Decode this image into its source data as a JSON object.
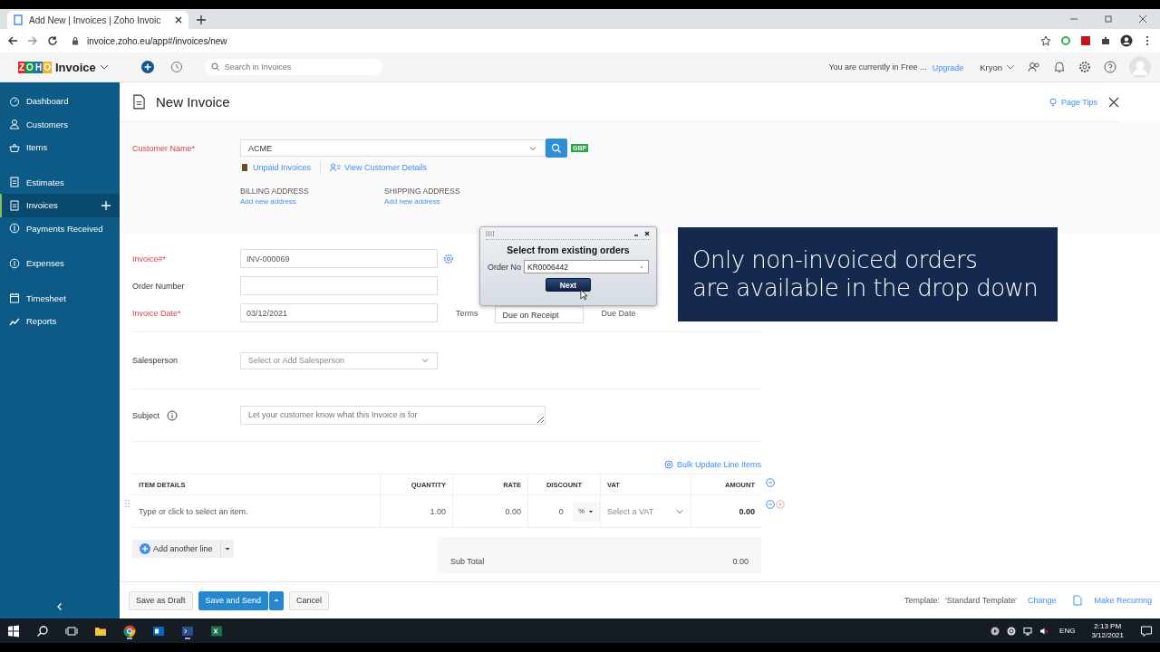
{
  "browser": {
    "tab_title": "Add New | Invoices | Zoho Invoic",
    "url": "invoice.zoho.eu/app#/invoices/new"
  },
  "app_header": {
    "logo_letters": "ZOHO",
    "logo_word": "Invoice",
    "search_placeholder": "Search in Invoices",
    "plan_notice": "You are currently in Free ...",
    "upgrade": "Upgrade",
    "org": "Kryon"
  },
  "sidebar": {
    "groups": [
      [
        {
          "label": "Dashboard",
          "selected": false,
          "add": false
        },
        {
          "label": "Customers",
          "selected": false,
          "add": false
        },
        {
          "label": "Items",
          "selected": false,
          "add": false
        }
      ],
      [
        {
          "label": "Estimates",
          "selected": false,
          "add": false
        },
        {
          "label": "Invoices",
          "selected": true,
          "add": true
        },
        {
          "label": "Payments Received",
          "selected": false,
          "add": false
        }
      ],
      [
        {
          "label": "Expenses",
          "selected": false,
          "add": false
        }
      ],
      [
        {
          "label": "Timesheet",
          "selected": false,
          "add": false
        },
        {
          "label": "Reports",
          "selected": false,
          "add": false
        }
      ]
    ]
  },
  "page": {
    "title": "New Invoice",
    "page_tips": "Page Tips"
  },
  "customer": {
    "label": "Customer Name*",
    "required": true,
    "value": "ACME",
    "currency": "GBP",
    "unpaid_link": "Unpaid Invoices",
    "details_link": "View Customer Details",
    "billing_heading": "BILLING ADDRESS",
    "billing_link": "Add new address",
    "shipping_heading": "SHIPPING ADDRESS",
    "shipping_link": "Add new address"
  },
  "fields": [
    {
      "label": "Invoice#*",
      "required": true,
      "value": "INV-000069",
      "kind": "settings"
    },
    {
      "label": "Order Number",
      "required": false,
      "kind": "plain"
    },
    {
      "label": "Invoice Date*",
      "required": true,
      "value": "03/12/2021",
      "kind": "terms"
    }
  ],
  "terms": {
    "label": "Terms",
    "value": "Due on Receipt",
    "due_label": "Due Date"
  },
  "salesperson": {
    "label": "Salesperson",
    "placeholder": "Select or Add Salesperson"
  },
  "subject": {
    "label": "Subject",
    "placeholder": "Let your customer know what this Invoice is for"
  },
  "items": {
    "bulk_update": "Bulk Update Line Items",
    "columns": [
      "ITEM DETAILS",
      "QUANTITY",
      "RATE",
      "DISCOUNT",
      "VAT",
      "AMOUNT"
    ],
    "row": {
      "placeholder": "Type or click to select an item.",
      "quantity": "1.00",
      "rate": "0.00",
      "discount": "0",
      "discount_unit": "%",
      "vat_placeholder": "Select a VAT",
      "amount": "0.00"
    },
    "add_line": "Add another line",
    "subtotal_label": "Sub Total",
    "subtotal_value": "0.00"
  },
  "footer": {
    "buttons": [
      "Save as Draft",
      "Save and Send",
      "Cancel"
    ],
    "template_label": "Template:",
    "template_name": "'Standard Template'",
    "change": "Change",
    "make_recurring": "Make Recurring"
  },
  "dialog": {
    "title": "Select from existing orders",
    "order_label": "Order No",
    "order_value": "KR0006442",
    "next": "Next"
  },
  "callout": {
    "lines": [
      "Only non-invoiced orders",
      "are available in the drop down"
    ]
  },
  "taskbar": {
    "language": "ENG",
    "time": "2:13 PM",
    "date": "3/12/2021"
  }
}
